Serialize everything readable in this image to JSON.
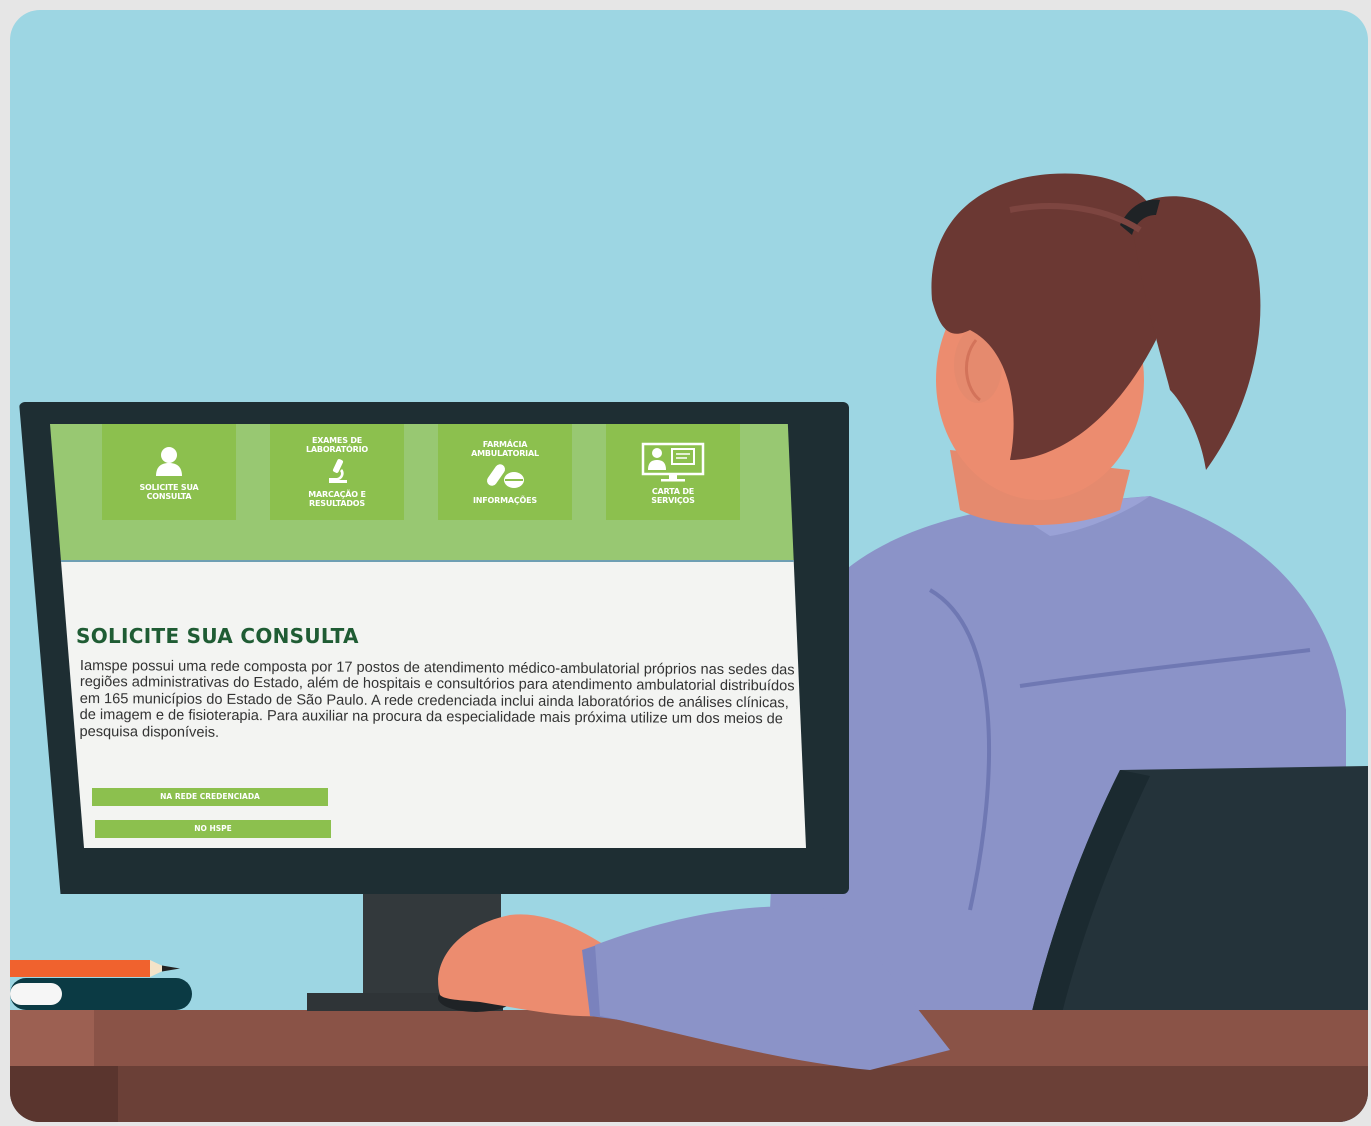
{
  "nav_tiles": [
    {
      "top_label": "",
      "bottom_label": "SOLICITE SUA\nCONSULTA",
      "icon": "user-icon"
    },
    {
      "top_label": "EXAMES DE\nLABORATÓRIO",
      "bottom_label": "MARCAÇÃO E\nRESULTADOS",
      "icon": "microscope-icon"
    },
    {
      "top_label": "FARMÁCIA\nAMBULATORIAL",
      "bottom_label": "INFORMAÇÕES",
      "icon": "pills-icon"
    },
    {
      "top_label": "",
      "bottom_label": "CARTA DE\nSERVIÇOS",
      "icon": "monitor-chat-icon"
    }
  ],
  "content": {
    "title": "SOLICITE SUA CONSULTA",
    "body": "Iamspe possui uma rede composta por 17 postos de atendimento médico-ambulatorial próprios nas sedes das regiões administrativas do Estado, além de hospitais e consultórios para atendimento ambulatorial distribuídos em 165 municípios do Estado de São Paulo. A rede credenciada inclui ainda laboratórios de análises clínicas, de imagem e de fisioterapia. Para auxiliar na procura da especialidade mais próxima utilize um dos meios de pesquisa disponíveis."
  },
  "buttons": {
    "rede_credenciada": "NA REDE CREDENCIADA",
    "hspe": "NO HSPE"
  },
  "colors": {
    "background": "#9dd6e3",
    "header_green": "#98c872",
    "tile_green": "#8cc04e",
    "title_green": "#1f5c34",
    "shirt": "#8b93c8",
    "hair": "#6b3833",
    "desk": "#8a5347"
  }
}
